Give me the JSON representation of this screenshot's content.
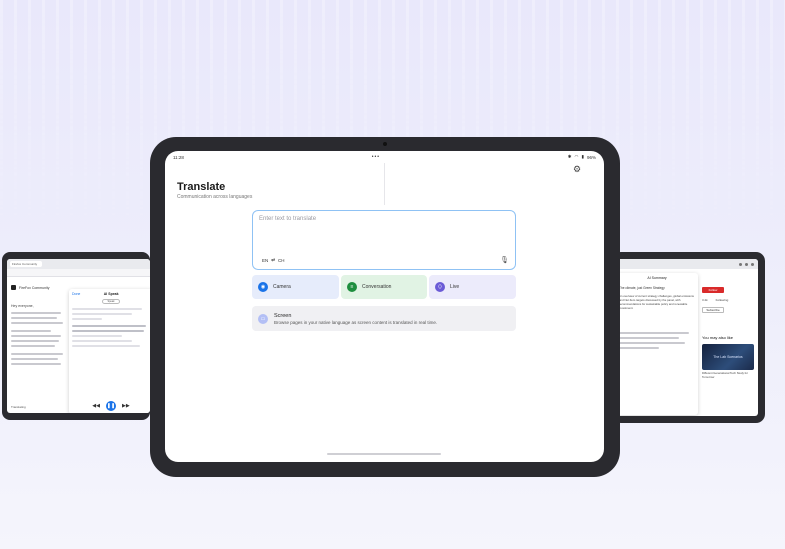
{
  "main": {
    "status": {
      "time": "11:28",
      "center_dots": "•••",
      "battery": "96%"
    },
    "title": "Translate",
    "subtitle": "Communication across languages",
    "input": {
      "placeholder": "Enter text to translate",
      "source_lang": "EN",
      "swap_symbol": "⇄",
      "target_lang": "CH"
    },
    "modes": {
      "camera": "Camera",
      "conversation": "Conversation",
      "live": "Live"
    },
    "screen_card": {
      "title": "Screen",
      "description": "Browse pages in your native language as screen content is translated in real time."
    }
  },
  "left_tablet": {
    "tab_label": "Firefox Community",
    "site_title": "FireFox Community",
    "body_text": "Hey everyone,",
    "panel": {
      "back": "Done",
      "title": "AI Speak",
      "pill": "Speak"
    },
    "footer_label": "Translating"
  },
  "right_tablet": {
    "panel_title": "AI Summary",
    "card_heading": "The climate, just Green Strategy",
    "body": "An overview of current strategy challenges, global emissions and Net Zero targets discussed by the panel, with recommendations for sustainable policy and renewable investment.",
    "red_button": "Follow",
    "meta_a": "3.2k",
    "meta_b": "Following",
    "grey_button": "Subscribe",
    "heading": "You may also like",
    "thumb_label": "The Lab Scenarios",
    "thumb_caption": "Different Generational Tech Study for Tomorrow"
  },
  "colors": {
    "accent_blue": "#1a73e8",
    "accent_green": "#1e8e3e",
    "accent_purple": "#6b5bd6",
    "input_border": "#8fc2f4"
  }
}
